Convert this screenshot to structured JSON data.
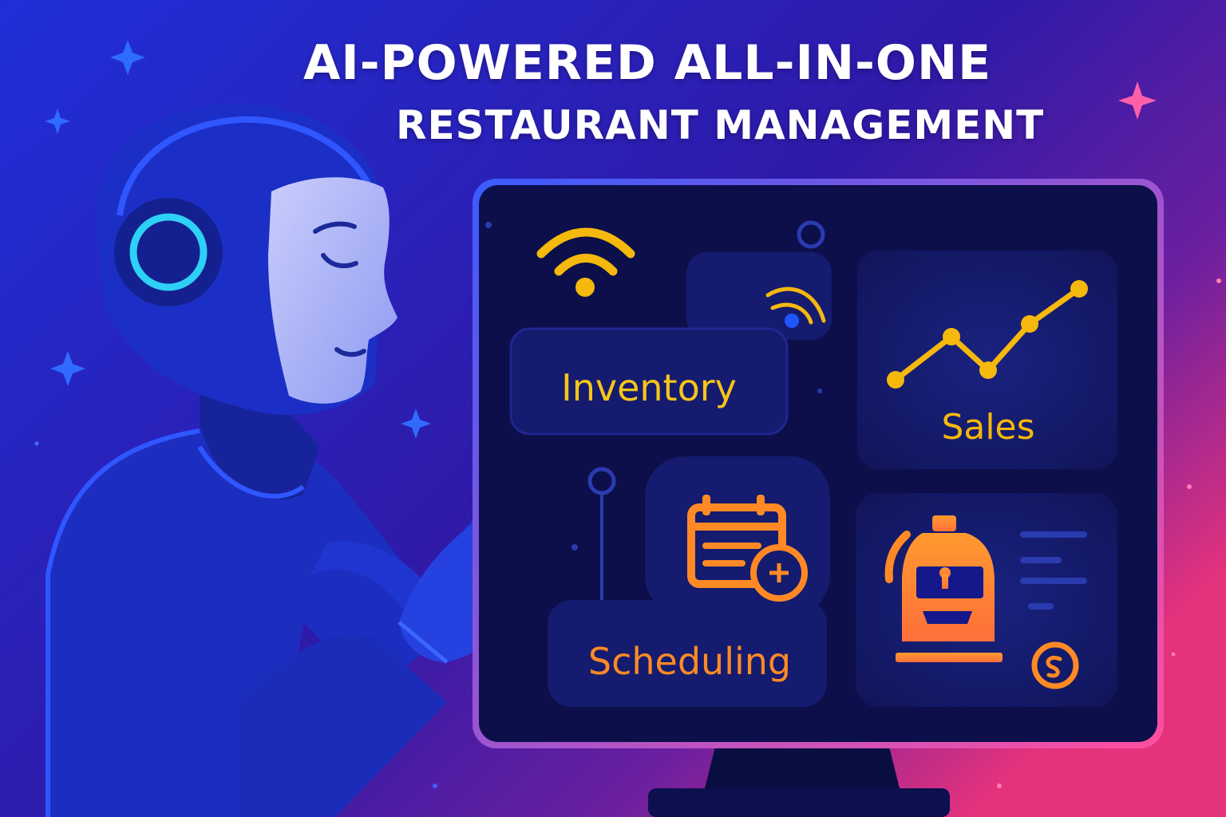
{
  "title": {
    "line1": "AI-POWERED ALL-IN-ONE",
    "line2": "RESTAURANT MANAGEMENT"
  },
  "tiles": {
    "inventory": "Inventory",
    "sales": "Sales",
    "scheduling": "Scheduling"
  },
  "icons": {
    "wifi": "wifi-icon",
    "chart": "line-chart-icon",
    "calendar": "calendar-add-icon",
    "register": "cash-register-icon",
    "coin": "coin-icon"
  },
  "colors": {
    "bg_start": "#1a2bd6",
    "bg_mid": "#3b1aa8",
    "bg_end": "#e0307a",
    "panel": "#0c0f4a",
    "tile": "#141a6a",
    "yellow": "#f5b80c",
    "orange": "#ff8a25",
    "robot_blue": "#1c34c8",
    "ring": "#29c6f0"
  }
}
